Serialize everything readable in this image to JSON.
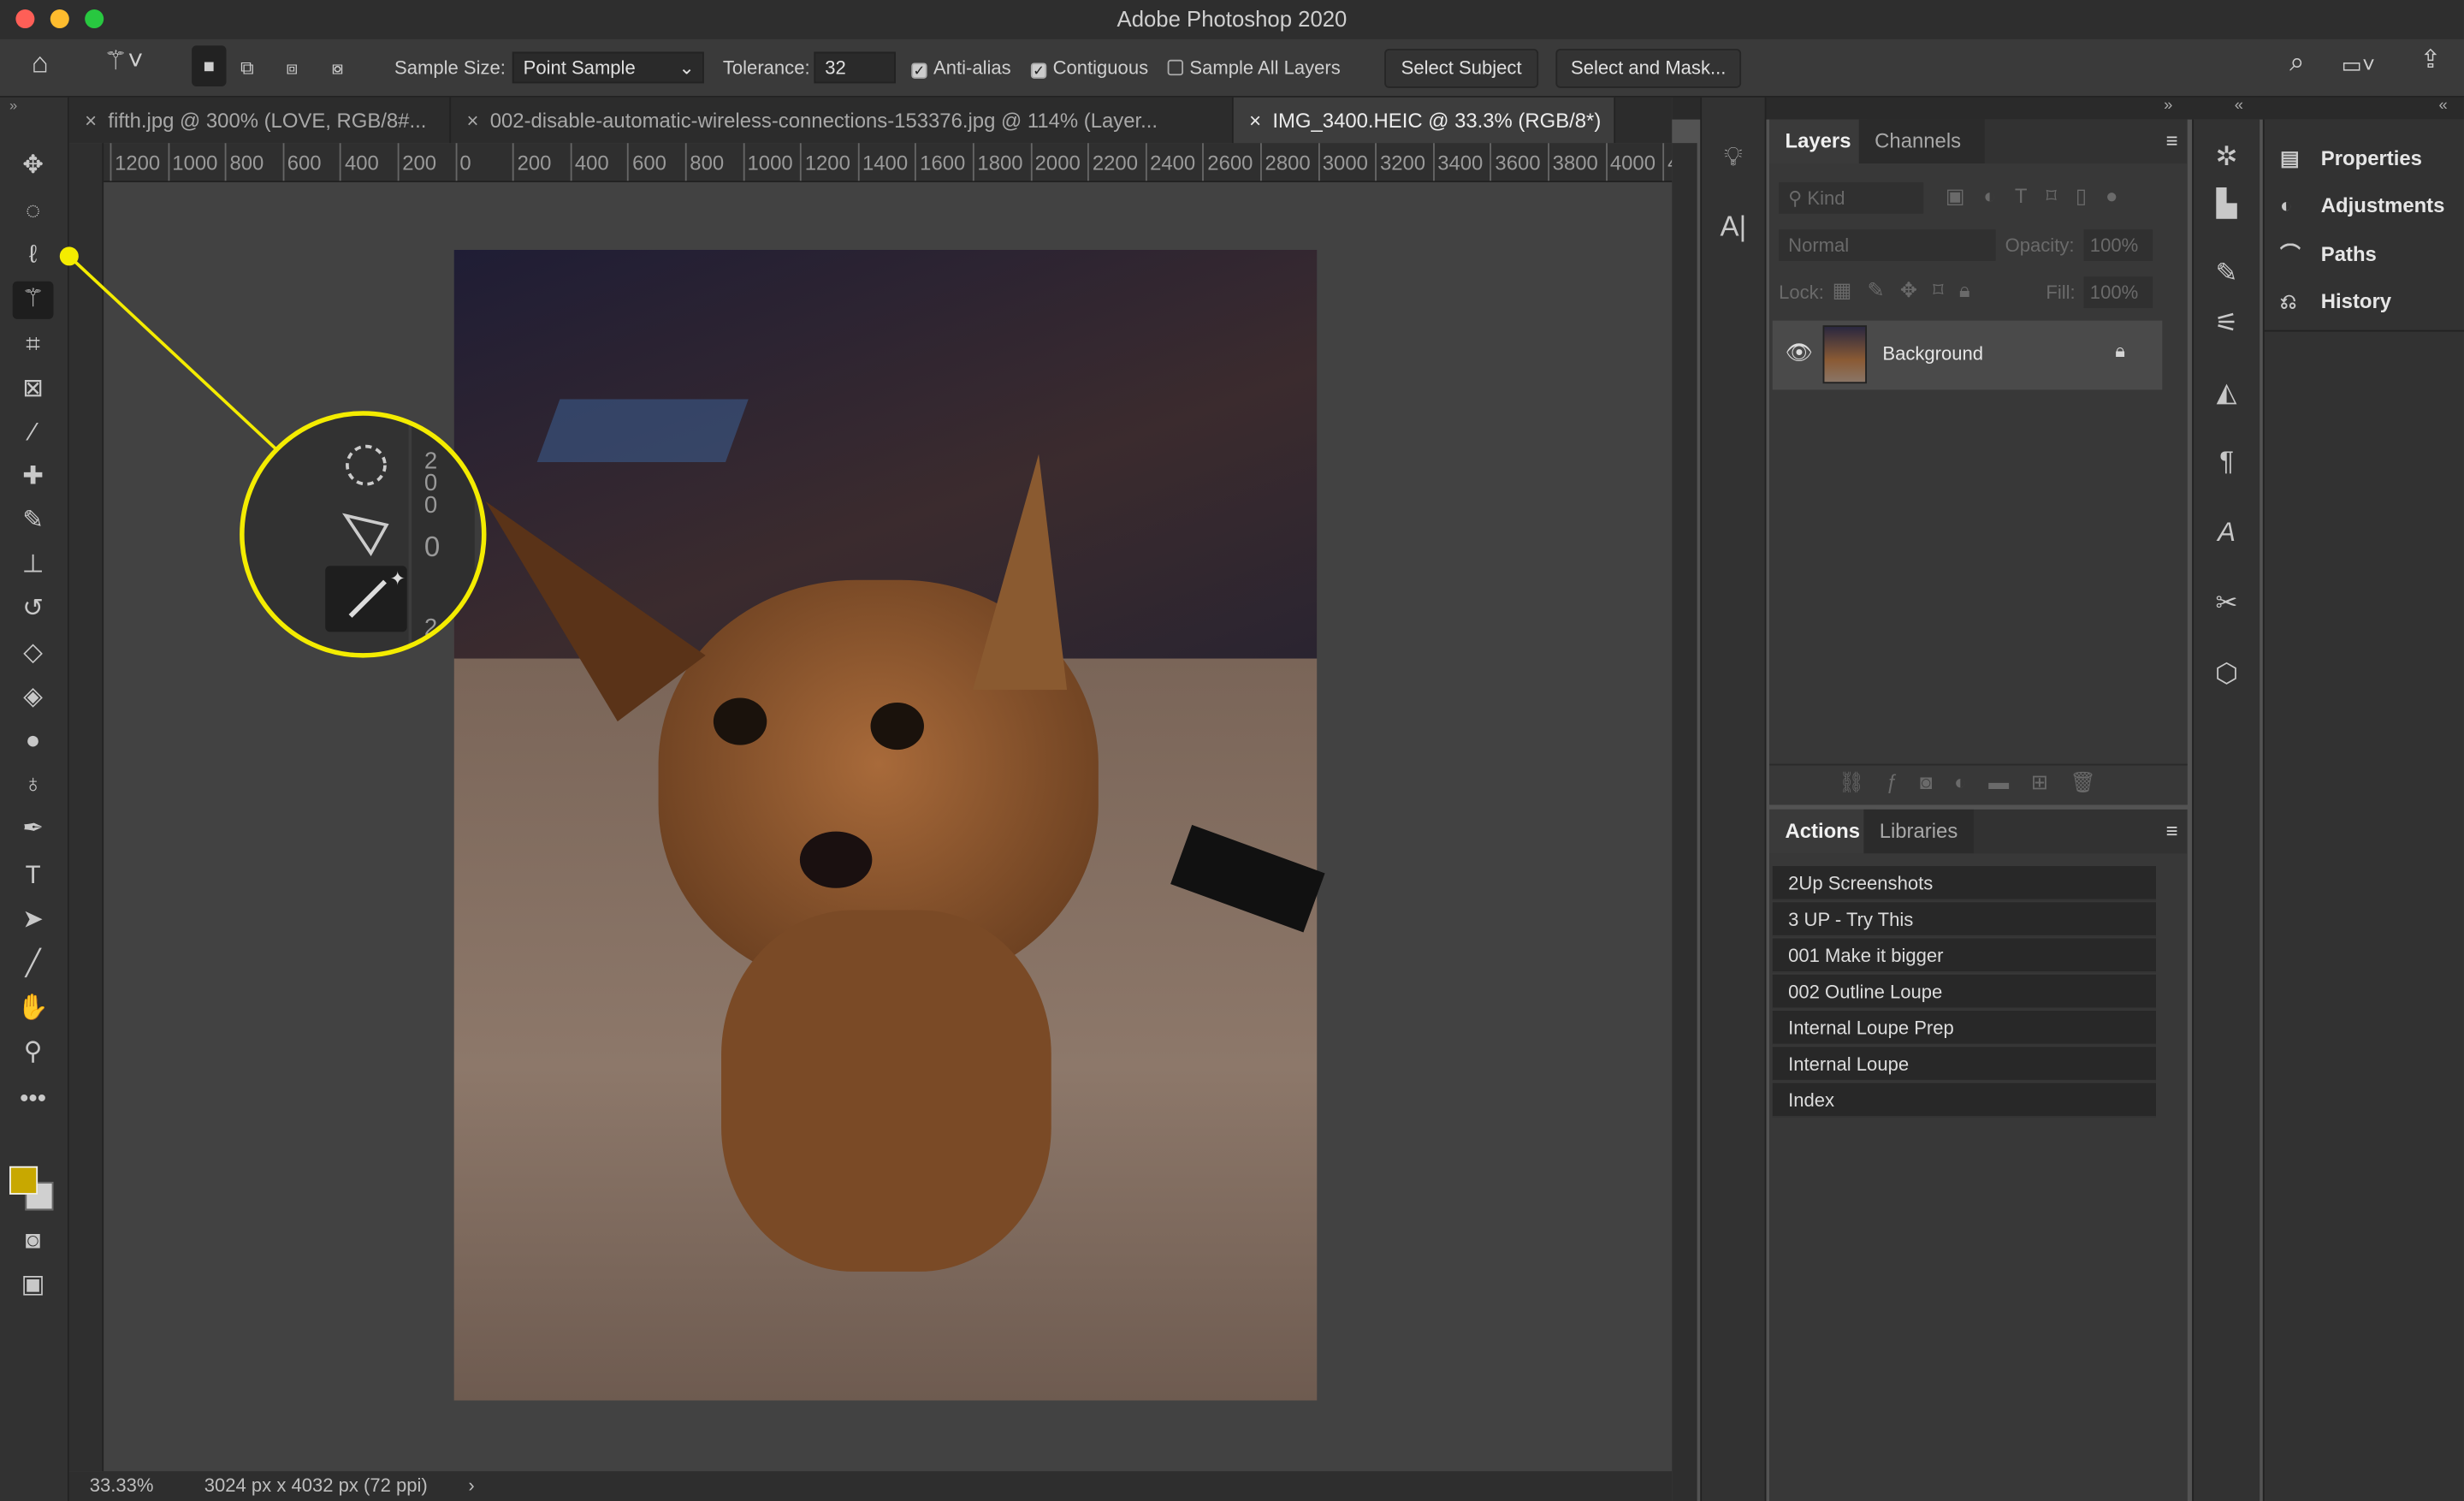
{
  "app": {
    "title": "Adobe Photoshop 2020"
  },
  "options_bar": {
    "sample_size_label": "Sample Size:",
    "sample_size_value": "Point Sample",
    "tolerance_label": "Tolerance:",
    "tolerance_value": "32",
    "anti_alias": {
      "label": "Anti-alias",
      "checked": true
    },
    "contiguous": {
      "label": "Contiguous",
      "checked": true
    },
    "sample_all_layers": {
      "label": "Sample All Layers",
      "checked": false
    },
    "select_subject": "Select Subject",
    "select_and_mask": "Select and Mask..."
  },
  "tabs": [
    {
      "label": "fifth.jpg @ 300% (LOVE, RGB/8#...",
      "active": false
    },
    {
      "label": "002-disable-automatic-wireless-connections-153376.jpg @ 114% (Layer...",
      "active": false
    },
    {
      "label": "IMG_3400.HEIC @ 33.3% (RGB/8*) *",
      "active": true
    }
  ],
  "ruler": {
    "labels": [
      "1200",
      "1000",
      "800",
      "600",
      "400",
      "200",
      "0",
      "200",
      "400",
      "600",
      "800",
      "1000",
      "1200",
      "1400",
      "1600",
      "1800",
      "2000",
      "2200",
      "2400",
      "2600",
      "2800",
      "3000",
      "3200",
      "3400",
      "3600",
      "3800",
      "4000",
      "4"
    ]
  },
  "status": {
    "zoom": "33.33%",
    "doc_info": "3024 px x 4032 px (72 ppi)"
  },
  "colors": {
    "foreground": "#c8a800",
    "background": "#d0d0d0",
    "callout": "#f4ec00"
  },
  "layers_panel": {
    "tabs": [
      "Layers",
      "Channels"
    ],
    "filter_placeholder": "Kind",
    "blend_mode": "Normal",
    "opacity_label": "Opacity:",
    "opacity_value": "100%",
    "lock_label": "Lock:",
    "fill_label": "Fill:",
    "fill_value": "100%",
    "layers": [
      {
        "name": "Background",
        "visible": true,
        "locked": true
      }
    ]
  },
  "actions_panel": {
    "tabs": [
      "Actions",
      "Libraries"
    ],
    "items": [
      "2Up Screenshots",
      "3 UP - Try This",
      "001 Make it bigger",
      "002 Outline Loupe",
      "Internal Loupe Prep",
      "Internal Loupe",
      "Index"
    ]
  },
  "right_panel": {
    "items": [
      {
        "label": "Properties",
        "icon": "properties-icon"
      },
      {
        "label": "Adjustments",
        "icon": "adjustments-icon"
      },
      {
        "label": "Paths",
        "icon": "paths-icon"
      },
      {
        "label": "History",
        "icon": "history-icon"
      }
    ]
  }
}
